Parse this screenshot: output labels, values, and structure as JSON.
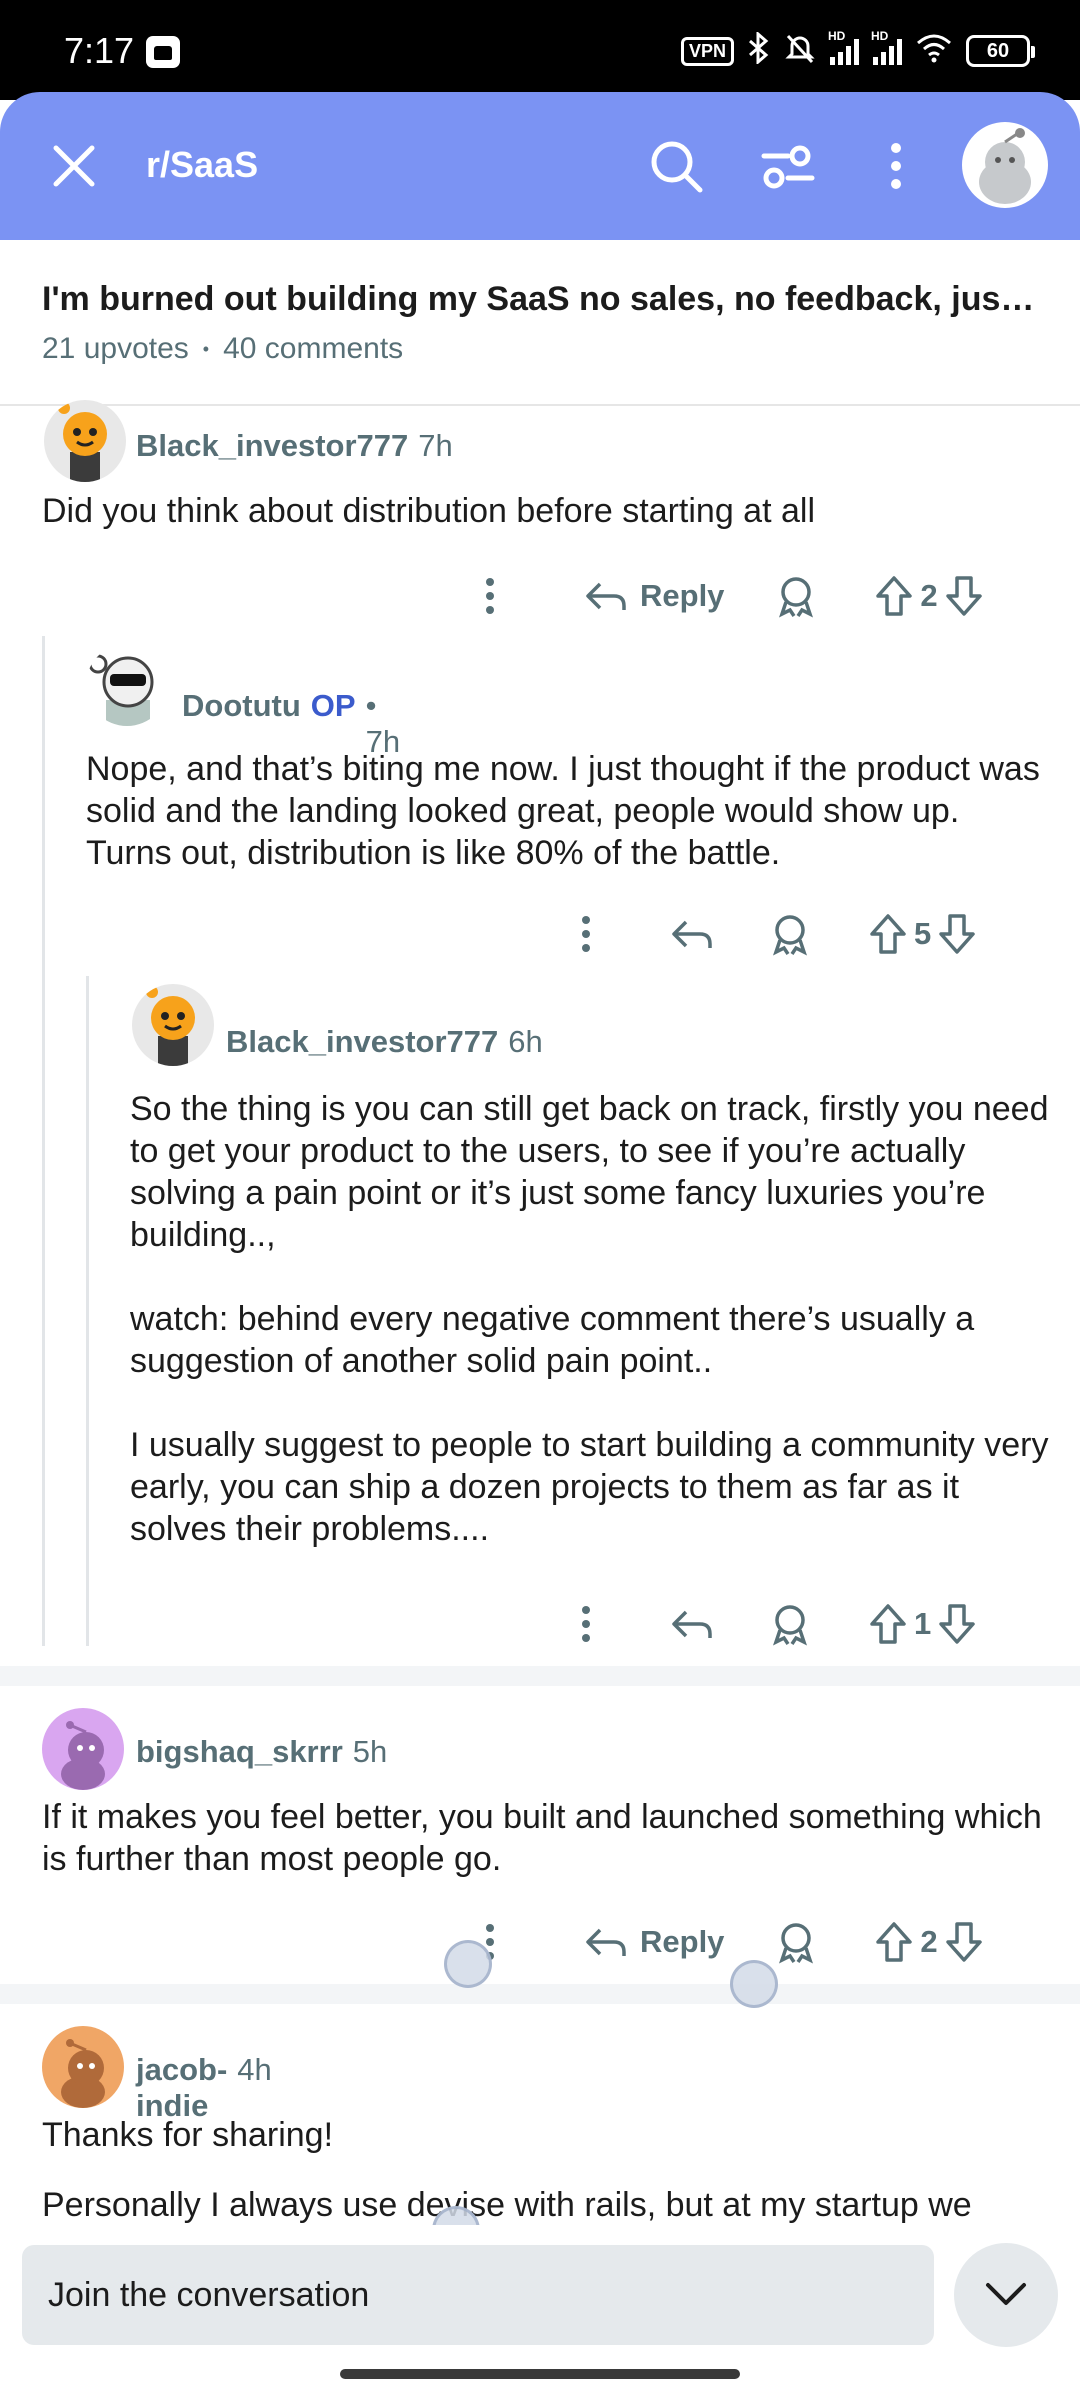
{
  "status_bar": {
    "time": "7:17",
    "vpn": "VPN",
    "battery": "60",
    "signal_hd": "HD"
  },
  "header": {
    "subreddit": "r/SaaS",
    "accent_color": "#7b93f3",
    "icons": [
      "close-icon",
      "search-icon",
      "sort-filter-icon",
      "more-vertical-icon",
      "user-avatar-icon"
    ]
  },
  "post": {
    "title": "I'm burned out building my SaaS no sales, no feedback, just ...",
    "upvotes": "21 upvotes",
    "separator": "•",
    "comments": "40 comments"
  },
  "comments": [
    {
      "author": "Black_investor777",
      "time": "7h",
      "body": [
        "Did you think about distribution before starting at all"
      ],
      "reply_label": "Reply",
      "votes": "2"
    },
    {
      "author": "Dootutu",
      "op_badge": "OP",
      "time": "• 7h",
      "body": [
        "Nope, and that’s biting me now. I just thought if the product was solid and the landing looked great, people would show up. Turns out, distribution is like 80% of the battle."
      ],
      "votes": "5"
    },
    {
      "author": "Black_investor777",
      "time": "6h",
      "body": [
        "So the thing is you can still get back on track, firstly you need to get your product to the users, to see if you’re actually solving a pain point or it’s just some fancy luxuries you’re building..,",
        "watch: behind every negative comment there’s usually a suggestion of another solid pain point..",
        "I usually suggest to people to start building a community very early, you can ship a dozen projects to them as far as it solves their problems...."
      ],
      "votes": "1"
    },
    {
      "author": "bigshaq_skrrr",
      "time": "5h",
      "body": [
        "If it makes you feel better, you built and launched something which is further than most people go."
      ],
      "reply_label": "Reply",
      "votes": "2"
    },
    {
      "author": "jacob-indie",
      "time": "4h",
      "body": [
        "Thanks for sharing!",
        "Personally I always use devise with rails, but at my startup we"
      ]
    }
  ],
  "bottom": {
    "placeholder": "Join the conversation"
  }
}
